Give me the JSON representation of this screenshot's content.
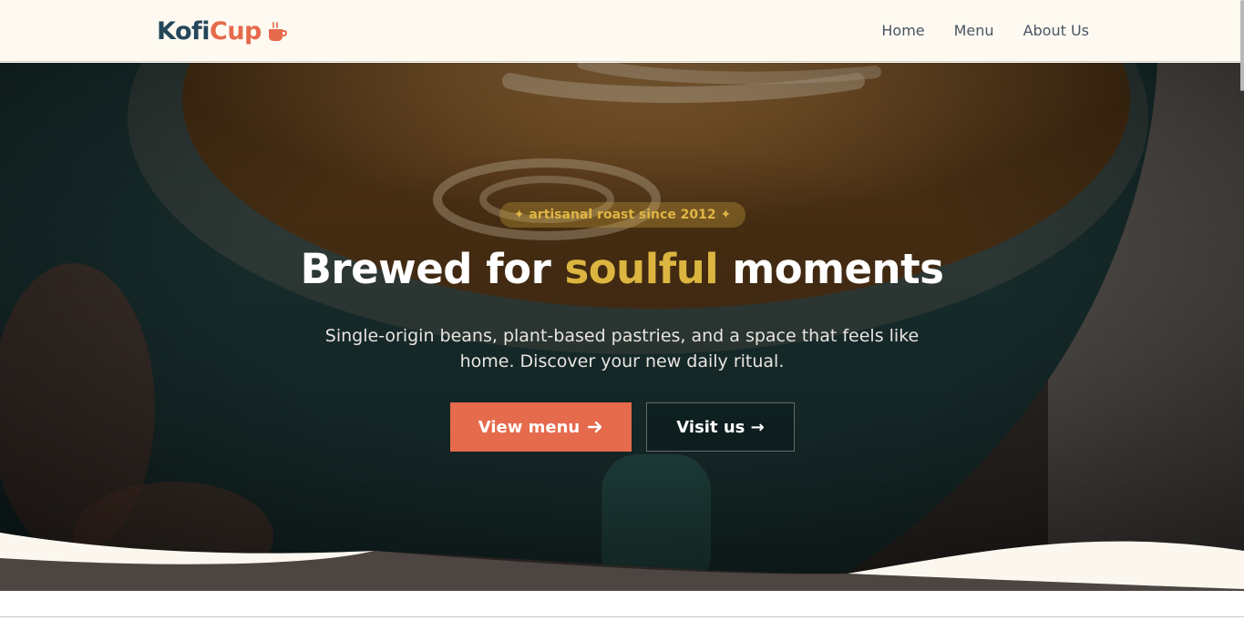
{
  "brand": {
    "name_part1": "Kofi",
    "name_part2": "Cup",
    "icon": "coffee-cup-icon",
    "colors": {
      "primary": "#24475a",
      "accent": "#e66a4c"
    }
  },
  "nav": {
    "items": [
      {
        "label": "Home"
      },
      {
        "label": "Menu"
      },
      {
        "label": "About Us"
      }
    ]
  },
  "hero": {
    "badge": "✦ artisanal roast since 2012 ✦",
    "title_before": "Brewed for",
    "title_accent": "soulful",
    "title_after": "moments",
    "subtitle": "Single-origin beans, plant-based pastries, and a space that feels like home. Discover your new daily ritual.",
    "primary_button": "View menu",
    "secondary_button": "Visit us →",
    "colors": {
      "accent_text": "#dcb540",
      "button": "#e66a4c"
    }
  }
}
